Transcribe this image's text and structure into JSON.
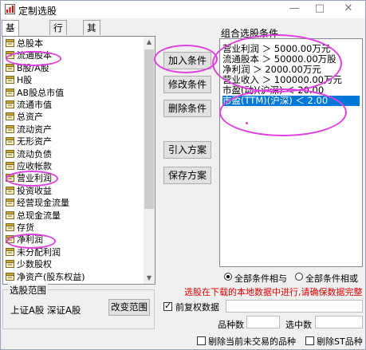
{
  "window": {
    "title": "定制选股",
    "minimize": "—",
    "maximize": "□",
    "close": "✕"
  },
  "tabs": [
    {
      "label": "基本资料",
      "active": true
    },
    {
      "label": "行情",
      "active": false
    },
    {
      "label": "其它条件",
      "active": false
    }
  ],
  "field_list": [
    "总股本",
    "流通股本",
    "B股/A股",
    "H股",
    "AB股总市值",
    "流通市值",
    "总资产",
    "流动资产",
    "无形资产",
    "流动负债",
    "应收帐款",
    "营业利润",
    "投资收益",
    "经营现金流量",
    "总现金流量",
    "存货",
    "净利润",
    "未分配利润",
    "少数股权",
    "净资产(股东权益)"
  ],
  "actions": {
    "add": "加入条件",
    "modify": "修改条件",
    "delete": "删除条件",
    "import": "引入方案",
    "save": "保存方案"
  },
  "conditions": {
    "label": "组合选股条件",
    "items": [
      "营业利润 ＞ 5000.00万元",
      "流通股本 ＞ 50000.00万股",
      "净利润 ＞ 2000.00万元",
      "营业收入 ＞ 100000.00万元",
      "市盈(动)(沪深) ＜ 20.00",
      "市盈(TTM)(沪深) ＜ 2.00"
    ],
    "selected_index": 5
  },
  "logic": {
    "and_label": "全部条件相与",
    "or_label": "全部条件相或",
    "selected": "and"
  },
  "warning": "选股在下载的本地数据中进行,请确保数据完整",
  "scope": {
    "legend": "选股范围",
    "value": "上证A股 深证A股",
    "change_button": "改变范围"
  },
  "adjusted": {
    "label": "前复权数据",
    "checked": true
  },
  "stats": {
    "count_label": "品种数",
    "selected_label": "选中数"
  },
  "filters": {
    "exclude_untraded": "剔除当前未交易的品种",
    "exclude_st": "剔除ST品种"
  },
  "colors": {
    "highlight": "#0078d7",
    "warning": "#e00000",
    "annotation": "#e040e0"
  }
}
